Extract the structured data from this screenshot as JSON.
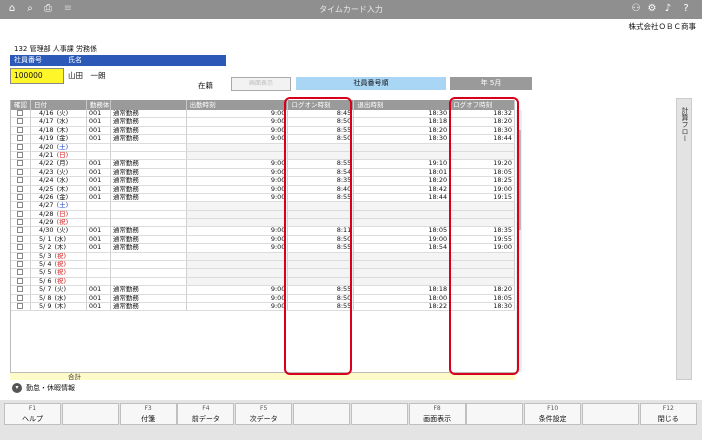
{
  "window": {
    "title": "タイムカード入力",
    "company": "株式会社ＯＢＣ商事"
  },
  "toolbar_icons": [
    "home-icon",
    "search-icon",
    "print-icon",
    "menu-icon",
    "user-icon",
    "settings-icon",
    "bell-icon",
    "help-icon"
  ],
  "employee": {
    "dept": "132 管理部 人事課 労務係",
    "id_label": "社員番号",
    "name_label": "氏名",
    "id": "100000",
    "name": "山田　一朗",
    "status": "在籍"
  },
  "controls": {
    "disabled_button": "画面表示",
    "sort": "社員番号順",
    "year_month": "年 5月"
  },
  "table": {
    "headers": [
      "確認",
      "日付",
      "勤務体系",
      "",
      "出勤時刻",
      "ログオン時刻",
      "退出時刻",
      "ログオフ時刻"
    ],
    "rows": [
      {
        "date": "4/16",
        "dow": "(火)",
        "t": "w",
        "code": "001",
        "kind": "通常勤務",
        "in": "9:00",
        "logon": "8:45",
        "out": "18:30",
        "logoff": "18:32"
      },
      {
        "date": "4/17",
        "dow": "(水)",
        "t": "w",
        "code": "001",
        "kind": "通常勤務",
        "in": "9:00",
        "logon": "8:50",
        "out": "18:18",
        "logoff": "18:20"
      },
      {
        "date": "4/18",
        "dow": "(木)",
        "t": "w",
        "code": "001",
        "kind": "通常勤務",
        "in": "9:00",
        "logon": "8:55",
        "out": "18:20",
        "logoff": "18:30"
      },
      {
        "date": "4/19",
        "dow": "(金)",
        "t": "w",
        "code": "001",
        "kind": "通常勤務",
        "in": "9:00",
        "logon": "8:50",
        "out": "18:30",
        "logoff": "18:44"
      },
      {
        "date": "4/20",
        "dow": "(土)",
        "t": "sat",
        "code": "",
        "kind": "",
        "in": "",
        "logon": "",
        "out": "",
        "logoff": ""
      },
      {
        "date": "4/21",
        "dow": "(日)",
        "t": "hol",
        "code": "",
        "kind": "",
        "in": "",
        "logon": "",
        "out": "",
        "logoff": ""
      },
      {
        "date": "4/22",
        "dow": "(月)",
        "t": "w",
        "code": "001",
        "kind": "通常勤務",
        "in": "9:00",
        "logon": "8:55",
        "out": "19:10",
        "logoff": "19:20"
      },
      {
        "date": "4/23",
        "dow": "(火)",
        "t": "w",
        "code": "001",
        "kind": "通常勤務",
        "in": "9:00",
        "logon": "8:54",
        "out": "18:01",
        "logoff": "18:05"
      },
      {
        "date": "4/24",
        "dow": "(水)",
        "t": "w",
        "code": "001",
        "kind": "通常勤務",
        "in": "9:00",
        "logon": "8:35",
        "out": "18:20",
        "logoff": "18:25"
      },
      {
        "date": "4/25",
        "dow": "(木)",
        "t": "w",
        "code": "001",
        "kind": "通常勤務",
        "in": "9:00",
        "logon": "8:40",
        "out": "18:42",
        "logoff": "19:00"
      },
      {
        "date": "4/26",
        "dow": "(金)",
        "t": "w",
        "code": "001",
        "kind": "通常勤務",
        "in": "9:00",
        "logon": "8:55",
        "out": "18:44",
        "logoff": "19:15"
      },
      {
        "date": "4/27",
        "dow": "(土)",
        "t": "sat",
        "code": "",
        "kind": "",
        "in": "",
        "logon": "",
        "out": "",
        "logoff": ""
      },
      {
        "date": "4/28",
        "dow": "(日)",
        "t": "hol",
        "code": "",
        "kind": "",
        "in": "",
        "logon": "",
        "out": "",
        "logoff": ""
      },
      {
        "date": "4/29",
        "dow": "(祝)",
        "t": "hol",
        "code": "",
        "kind": "",
        "in": "",
        "logon": "",
        "out": "",
        "logoff": ""
      },
      {
        "date": "4/30",
        "dow": "(火)",
        "t": "w",
        "code": "001",
        "kind": "通常勤務",
        "in": "9:00",
        "logon": "8:11",
        "out": "18:05",
        "logoff": "18:35"
      },
      {
        "date": "5/ 1",
        "dow": "(水)",
        "t": "w",
        "code": "001",
        "kind": "通常勤務",
        "in": "9:00",
        "logon": "8:50",
        "out": "19:00",
        "logoff": "19:55"
      },
      {
        "date": "5/ 2",
        "dow": "(木)",
        "t": "w",
        "code": "001",
        "kind": "通常勤務",
        "in": "9:00",
        "logon": "8:55",
        "out": "18:54",
        "logoff": "19:00"
      },
      {
        "date": "5/ 3",
        "dow": "(祝)",
        "t": "hol",
        "code": "",
        "kind": "",
        "in": "",
        "logon": "",
        "out": "",
        "logoff": ""
      },
      {
        "date": "5/ 4",
        "dow": "(祝)",
        "t": "hol",
        "code": "",
        "kind": "",
        "in": "",
        "logon": "",
        "out": "",
        "logoff": ""
      },
      {
        "date": "5/ 5",
        "dow": "(祝)",
        "t": "hol",
        "code": "",
        "kind": "",
        "in": "",
        "logon": "",
        "out": "",
        "logoff": ""
      },
      {
        "date": "5/ 6",
        "dow": "(祝)",
        "t": "hol",
        "code": "",
        "kind": "",
        "in": "",
        "logon": "",
        "out": "",
        "logoff": ""
      },
      {
        "date": "5/ 7",
        "dow": "(火)",
        "t": "w",
        "code": "001",
        "kind": "通常勤務",
        "in": "9:00",
        "logon": "8:55",
        "out": "18:18",
        "logoff": "18:20"
      },
      {
        "date": "5/ 8",
        "dow": "(水)",
        "t": "w",
        "code": "001",
        "kind": "通常勤務",
        "in": "9:00",
        "logon": "8:50",
        "out": "18:00",
        "logoff": "18:05"
      },
      {
        "date": "5/ 9",
        "dow": "(木)",
        "t": "w",
        "code": "001",
        "kind": "通常勤務",
        "in": "9:00",
        "logon": "8:55",
        "out": "18:22",
        "logoff": "18:30"
      }
    ],
    "total_label": "合計"
  },
  "side_tab": "計算フロー",
  "info_label": "勤怠・休暇情報",
  "fkeys": [
    {
      "key": "F1",
      "label": "ヘルプ"
    },
    {
      "key": "",
      "label": ""
    },
    {
      "key": "F3",
      "label": "付箋"
    },
    {
      "key": "F4",
      "label": "前データ"
    },
    {
      "key": "F5",
      "label": "次データ"
    },
    {
      "key": "",
      "label": ""
    },
    {
      "key": "",
      "label": ""
    },
    {
      "key": "F8",
      "label": "画面表示"
    },
    {
      "key": "",
      "label": ""
    },
    {
      "key": "F10",
      "label": "条件設定"
    },
    {
      "key": "",
      "label": ""
    },
    {
      "key": "F12",
      "label": "閉じる"
    }
  ],
  "colors": {
    "accent": "#2c59b8",
    "highlight": "#d9001b",
    "id_bg": "#fff62a",
    "sort_bg": "#a9d6f5",
    "sat": "#1d3fd6",
    "holiday": "#d21c1c"
  }
}
